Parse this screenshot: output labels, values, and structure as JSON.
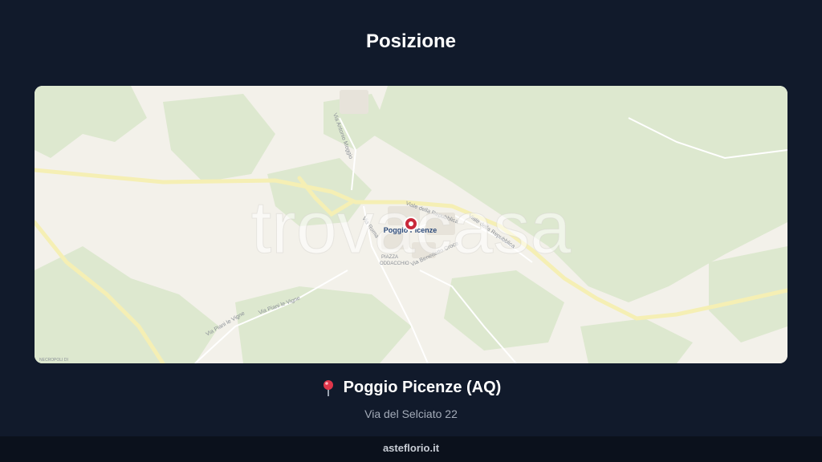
{
  "page": {
    "title": "Posizione"
  },
  "map": {
    "place_label": "Poggio Picenze",
    "watermark": "trovacasa",
    "streets": [
      "Viale della Repubblica",
      "Viale della Repubblica",
      "Via Roma",
      "Via Benedetto Croce",
      "Via Piani le Vigne",
      "Via Piani le Vigne",
      "Via Antonio Moggio"
    ],
    "poi": [
      "PIAZZA",
      "ODDACCHIO",
      "NECROPOLI DI"
    ],
    "colors": {
      "land": "#f3f1ea",
      "vegetation": "#dde8cf",
      "major_road": "#f5efb4",
      "marker": "#c9283a"
    }
  },
  "location": {
    "pin_icon": "round-pushpin",
    "name": "Poggio Picenze (AQ)",
    "address": "Via del Selciato 22"
  },
  "footer": {
    "brand": "asteflorio.it"
  }
}
